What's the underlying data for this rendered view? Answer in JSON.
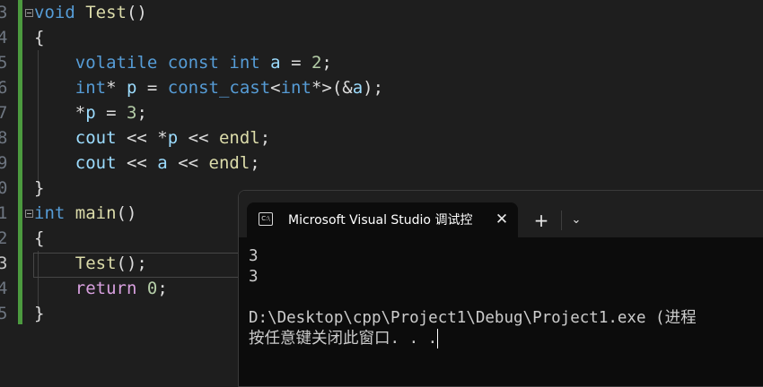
{
  "editor": {
    "line_numbers": [
      "3",
      "4",
      "5",
      "6",
      "7",
      "8",
      "9",
      "0",
      "1",
      "2",
      "3",
      "4",
      "5"
    ],
    "current_line_number": "3",
    "code": {
      "l1": {
        "kw": "void",
        "name": "Test",
        "rest": "()"
      },
      "l2": {
        "brace": "{"
      },
      "l3": {
        "kw1": "volatile",
        "kw2": "const",
        "kw3": "int",
        "var": "a",
        "op": " = ",
        "num": "2",
        "end": ";"
      },
      "l4": {
        "kw": "int",
        "op1": "* ",
        "var1": "p",
        "op2": " = ",
        "kw2": "const_cast",
        "op3": "<",
        "kw3": "int",
        "op4": "*>(&",
        "var2": "a",
        "end": ");"
      },
      "l5": {
        "op1": "*",
        "var": "p",
        "op2": " = ",
        "num": "3",
        "end": ";"
      },
      "l6": {
        "var1": "cout",
        "op1": " << *",
        "var2": "p",
        "op2": " << ",
        "var3": "endl",
        "end": ";"
      },
      "l7": {
        "var1": "cout",
        "op1": " << ",
        "var2": "a",
        "op2": " << ",
        "var3": "endl",
        "end": ";"
      },
      "l8": {
        "brace": "}"
      },
      "l9": {
        "kw": "int",
        "name": "main",
        "rest": "()"
      },
      "l10": {
        "brace": "{"
      },
      "l11": {
        "name": "Test",
        "rest": "();"
      },
      "l12": {
        "kw": "return",
        "num": "0",
        "end": ";"
      },
      "l13": {
        "brace": "}"
      }
    }
  },
  "terminal": {
    "tab_title": "Microsoft Visual Studio 调试控制台",
    "tab_icon_text": "C:\\",
    "close_glyph": "✕",
    "new_tab_glyph": "+",
    "dropdown_glyph": "⌄",
    "output": [
      "3",
      "3",
      "",
      "D:\\Desktop\\cpp\\Project1\\Debug\\Project1.exe (进程",
      "按任意键关闭此窗口. . ."
    ]
  },
  "colors": {
    "editor_bg": "#1e1e1e",
    "keyword": "#569cd6",
    "function": "#dcdcaa",
    "variable": "#9cdcfe",
    "number": "#b5cea8",
    "control": "#d8a0df",
    "change_bar": "#4c9a3f",
    "terminal_bg": "#0c0c0c"
  }
}
